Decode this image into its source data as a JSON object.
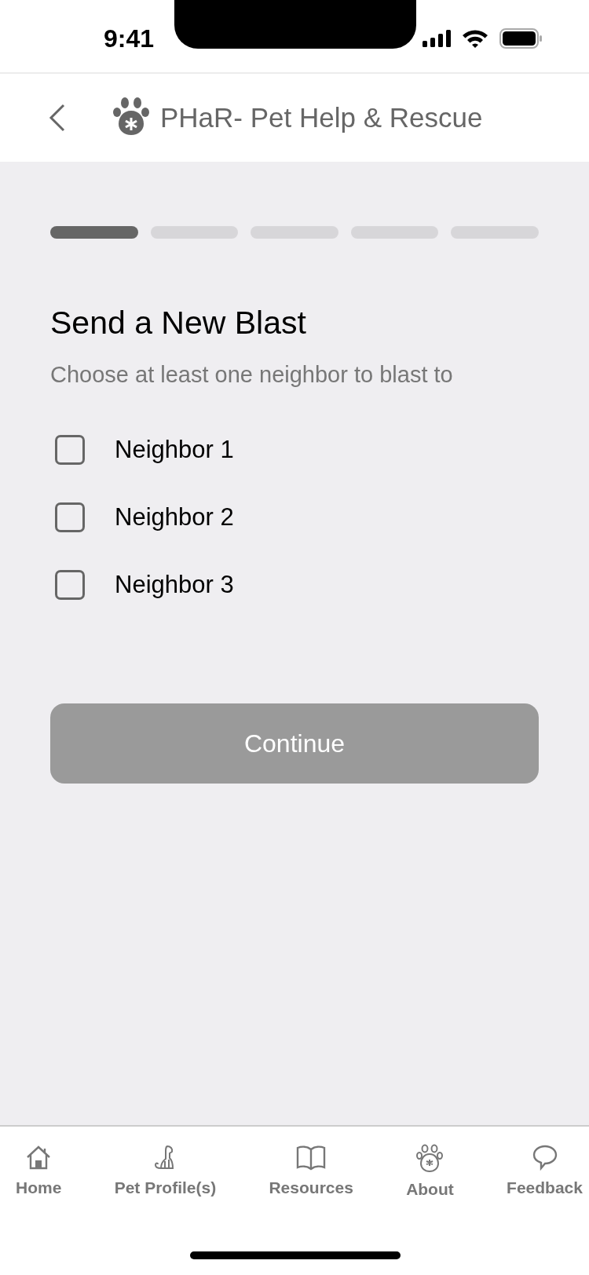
{
  "status_bar": {
    "time": "9:41"
  },
  "header": {
    "title": "PHaR- Pet Help & Rescue"
  },
  "progress": {
    "steps": [
      {
        "complete": true
      },
      {
        "complete": false
      },
      {
        "complete": false
      },
      {
        "complete": false
      },
      {
        "complete": false
      }
    ]
  },
  "heading": "Send a New Blast",
  "subtitle": "Choose at least one neighbor to blast to",
  "neighbors": [
    {
      "label": "Neighbor 1",
      "checked": false
    },
    {
      "label": "Neighbor 2",
      "checked": false
    },
    {
      "label": "Neighbor 3",
      "checked": false
    }
  ],
  "continue_button": {
    "label": "Continue",
    "disabled": true
  },
  "tab_bar": [
    {
      "kind": "home",
      "label": "Home"
    },
    {
      "kind": "pet",
      "label": "Pet Profile(s)"
    },
    {
      "kind": "book",
      "label": "Resources"
    },
    {
      "kind": "paw",
      "label": "About"
    },
    {
      "kind": "chat",
      "label": "Feedback"
    }
  ]
}
